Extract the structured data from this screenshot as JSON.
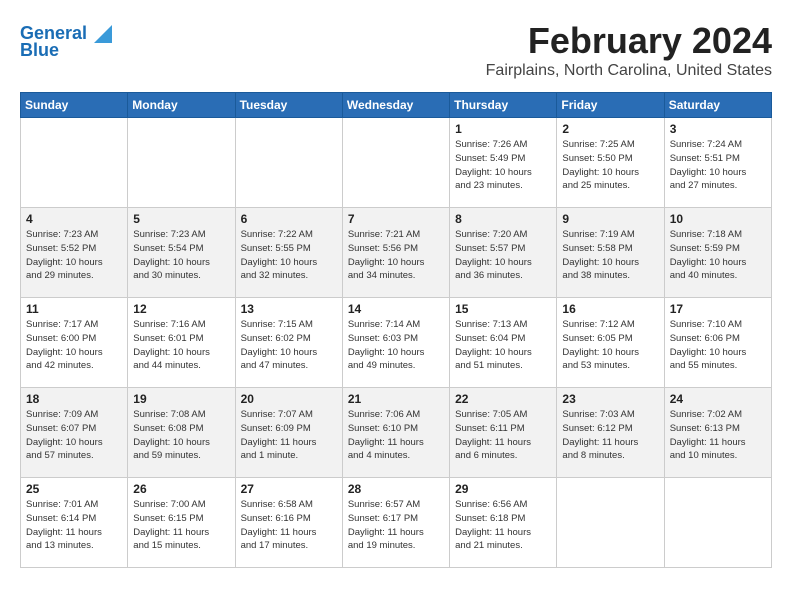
{
  "app": {
    "logo_line1": "General",
    "logo_line2": "Blue"
  },
  "header": {
    "title": "February 2024",
    "subtitle": "Fairplains, North Carolina, United States"
  },
  "days_of_week": [
    "Sunday",
    "Monday",
    "Tuesday",
    "Wednesday",
    "Thursday",
    "Friday",
    "Saturday"
  ],
  "weeks": [
    [
      {
        "day": "",
        "info": ""
      },
      {
        "day": "",
        "info": ""
      },
      {
        "day": "",
        "info": ""
      },
      {
        "day": "",
        "info": ""
      },
      {
        "day": "1",
        "info": "Sunrise: 7:26 AM\nSunset: 5:49 PM\nDaylight: 10 hours\nand 23 minutes."
      },
      {
        "day": "2",
        "info": "Sunrise: 7:25 AM\nSunset: 5:50 PM\nDaylight: 10 hours\nand 25 minutes."
      },
      {
        "day": "3",
        "info": "Sunrise: 7:24 AM\nSunset: 5:51 PM\nDaylight: 10 hours\nand 27 minutes."
      }
    ],
    [
      {
        "day": "4",
        "info": "Sunrise: 7:23 AM\nSunset: 5:52 PM\nDaylight: 10 hours\nand 29 minutes."
      },
      {
        "day": "5",
        "info": "Sunrise: 7:23 AM\nSunset: 5:54 PM\nDaylight: 10 hours\nand 30 minutes."
      },
      {
        "day": "6",
        "info": "Sunrise: 7:22 AM\nSunset: 5:55 PM\nDaylight: 10 hours\nand 32 minutes."
      },
      {
        "day": "7",
        "info": "Sunrise: 7:21 AM\nSunset: 5:56 PM\nDaylight: 10 hours\nand 34 minutes."
      },
      {
        "day": "8",
        "info": "Sunrise: 7:20 AM\nSunset: 5:57 PM\nDaylight: 10 hours\nand 36 minutes."
      },
      {
        "day": "9",
        "info": "Sunrise: 7:19 AM\nSunset: 5:58 PM\nDaylight: 10 hours\nand 38 minutes."
      },
      {
        "day": "10",
        "info": "Sunrise: 7:18 AM\nSunset: 5:59 PM\nDaylight: 10 hours\nand 40 minutes."
      }
    ],
    [
      {
        "day": "11",
        "info": "Sunrise: 7:17 AM\nSunset: 6:00 PM\nDaylight: 10 hours\nand 42 minutes."
      },
      {
        "day": "12",
        "info": "Sunrise: 7:16 AM\nSunset: 6:01 PM\nDaylight: 10 hours\nand 44 minutes."
      },
      {
        "day": "13",
        "info": "Sunrise: 7:15 AM\nSunset: 6:02 PM\nDaylight: 10 hours\nand 47 minutes."
      },
      {
        "day": "14",
        "info": "Sunrise: 7:14 AM\nSunset: 6:03 PM\nDaylight: 10 hours\nand 49 minutes."
      },
      {
        "day": "15",
        "info": "Sunrise: 7:13 AM\nSunset: 6:04 PM\nDaylight: 10 hours\nand 51 minutes."
      },
      {
        "day": "16",
        "info": "Sunrise: 7:12 AM\nSunset: 6:05 PM\nDaylight: 10 hours\nand 53 minutes."
      },
      {
        "day": "17",
        "info": "Sunrise: 7:10 AM\nSunset: 6:06 PM\nDaylight: 10 hours\nand 55 minutes."
      }
    ],
    [
      {
        "day": "18",
        "info": "Sunrise: 7:09 AM\nSunset: 6:07 PM\nDaylight: 10 hours\nand 57 minutes."
      },
      {
        "day": "19",
        "info": "Sunrise: 7:08 AM\nSunset: 6:08 PM\nDaylight: 10 hours\nand 59 minutes."
      },
      {
        "day": "20",
        "info": "Sunrise: 7:07 AM\nSunset: 6:09 PM\nDaylight: 11 hours\nand 1 minute."
      },
      {
        "day": "21",
        "info": "Sunrise: 7:06 AM\nSunset: 6:10 PM\nDaylight: 11 hours\nand 4 minutes."
      },
      {
        "day": "22",
        "info": "Sunrise: 7:05 AM\nSunset: 6:11 PM\nDaylight: 11 hours\nand 6 minutes."
      },
      {
        "day": "23",
        "info": "Sunrise: 7:03 AM\nSunset: 6:12 PM\nDaylight: 11 hours\nand 8 minutes."
      },
      {
        "day": "24",
        "info": "Sunrise: 7:02 AM\nSunset: 6:13 PM\nDaylight: 11 hours\nand 10 minutes."
      }
    ],
    [
      {
        "day": "25",
        "info": "Sunrise: 7:01 AM\nSunset: 6:14 PM\nDaylight: 11 hours\nand 13 minutes."
      },
      {
        "day": "26",
        "info": "Sunrise: 7:00 AM\nSunset: 6:15 PM\nDaylight: 11 hours\nand 15 minutes."
      },
      {
        "day": "27",
        "info": "Sunrise: 6:58 AM\nSunset: 6:16 PM\nDaylight: 11 hours\nand 17 minutes."
      },
      {
        "day": "28",
        "info": "Sunrise: 6:57 AM\nSunset: 6:17 PM\nDaylight: 11 hours\nand 19 minutes."
      },
      {
        "day": "29",
        "info": "Sunrise: 6:56 AM\nSunset: 6:18 PM\nDaylight: 11 hours\nand 21 minutes."
      },
      {
        "day": "",
        "info": ""
      },
      {
        "day": "",
        "info": ""
      }
    ]
  ]
}
